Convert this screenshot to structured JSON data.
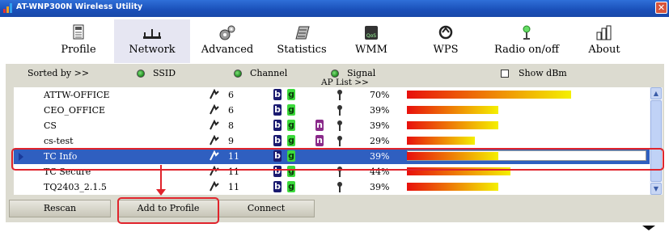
{
  "window": {
    "title": "AT-WNP300N Wireless Utility",
    "close_glyph": "✕"
  },
  "toolbar": [
    {
      "label": "Profile",
      "icon": "profile-icon"
    },
    {
      "label": "Network",
      "icon": "network-icon"
    },
    {
      "label": "Advanced",
      "icon": "advanced-icon"
    },
    {
      "label": "Statistics",
      "icon": "statistics-icon"
    },
    {
      "label": "WMM",
      "icon": "wmm-icon"
    },
    {
      "label": "WPS",
      "icon": "wps-icon"
    },
    {
      "label": "Radio on/off",
      "icon": "radio-icon"
    },
    {
      "label": "About",
      "icon": "about-icon"
    }
  ],
  "sortbar": {
    "sorted_by": "Sorted by >>",
    "ssid": "SSID",
    "channel": "Channel",
    "signal": "Signal",
    "show_dbm": "Show dBm",
    "ap_list": "AP List >>"
  },
  "networks": [
    {
      "ssid": "ATTW-OFFICE",
      "channel": "6",
      "b": true,
      "g": true,
      "n": false,
      "secured": true,
      "signal_pct": "70%",
      "signal": 0.7
    },
    {
      "ssid": "CEO_OFFICE",
      "channel": "6",
      "b": true,
      "g": true,
      "n": false,
      "secured": true,
      "signal_pct": "39%",
      "signal": 0.39
    },
    {
      "ssid": "CS",
      "channel": "8",
      "b": true,
      "g": true,
      "n": true,
      "secured": true,
      "signal_pct": "39%",
      "signal": 0.39
    },
    {
      "ssid": "cs-test",
      "channel": "9",
      "b": true,
      "g": true,
      "n": true,
      "secured": true,
      "signal_pct": "29%",
      "signal": 0.29
    },
    {
      "ssid": "TC Info",
      "channel": "11",
      "b": true,
      "g": true,
      "n": false,
      "secured": false,
      "signal_pct": "39%",
      "signal": 0.39,
      "selected": true
    },
    {
      "ssid": "TC Secure",
      "channel": "11",
      "b": true,
      "g": true,
      "n": false,
      "secured": true,
      "signal_pct": "44%",
      "signal": 0.44
    },
    {
      "ssid": "TQ2403_2.1.5",
      "channel": "11",
      "b": true,
      "g": true,
      "n": false,
      "secured": true,
      "signal_pct": "39%",
      "signal": 0.39
    }
  ],
  "badges": {
    "b": "b",
    "g": "g",
    "n": "n"
  },
  "buttons": {
    "rescan": "Rescan",
    "add_to_profile": "Add to Profile",
    "connect": "Connect"
  },
  "colors": {
    "selection": "#2f5fc0",
    "annotation": "#e0242c",
    "signal_start": "#e8100c",
    "signal_end": "#f4f000"
  }
}
